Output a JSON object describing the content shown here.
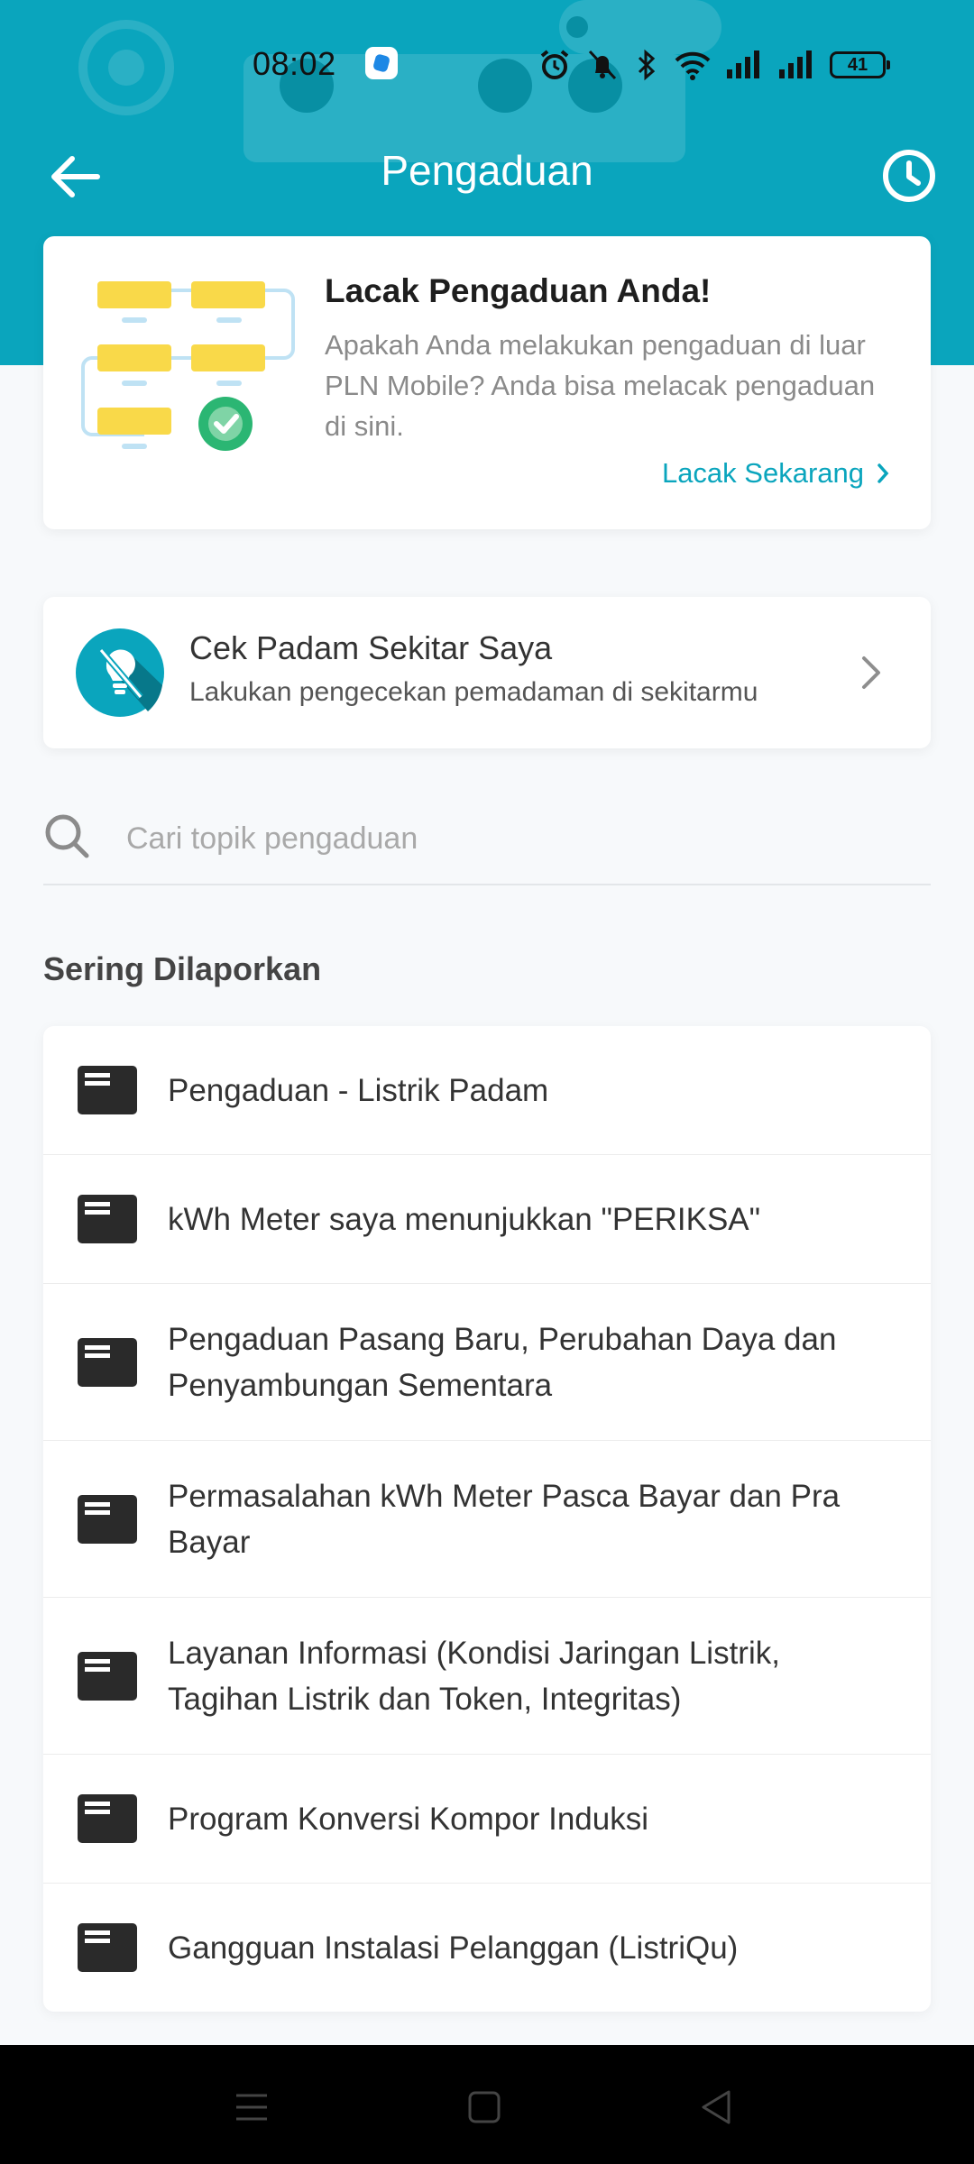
{
  "status_bar": {
    "time": "08:02",
    "battery": "41"
  },
  "header": {
    "title": "Pengaduan"
  },
  "track_card": {
    "title": "Lacak Pengaduan Anda!",
    "description": "Apakah Anda melakukan pengaduan di luar PLN Mobile? Anda bisa melacak pengaduan di sini.",
    "link_label": "Lacak Sekarang"
  },
  "outage_card": {
    "title": "Cek Padam Sekitar Saya",
    "subtitle": "Lakukan pengecekan pemadaman di sekitarmu"
  },
  "search": {
    "placeholder": "Cari topik pengaduan"
  },
  "frequent": {
    "title": "Sering Dilaporkan",
    "items": [
      {
        "label": "Pengaduan - Listrik Padam"
      },
      {
        "label": "kWh Meter saya menunjukkan \"PERIKSA\""
      },
      {
        "label": "Pengaduan Pasang Baru, Perubahan Daya dan Penyambungan Sementara"
      },
      {
        "label": "Permasalahan kWh Meter Pasca Bayar dan Pra Bayar"
      },
      {
        "label": "Layanan Informasi (Kondisi Jaringan Listrik, Tagihan Listrik dan Token, Integritas)"
      },
      {
        "label": "Program Konversi Kompor Induksi"
      },
      {
        "label": "Gangguan Instalasi Pelanggan (ListriQu)"
      }
    ]
  },
  "colors": {
    "primary": "#0aa5bd",
    "success": "#2bb673",
    "icon_dark": "#2a2a2a"
  }
}
